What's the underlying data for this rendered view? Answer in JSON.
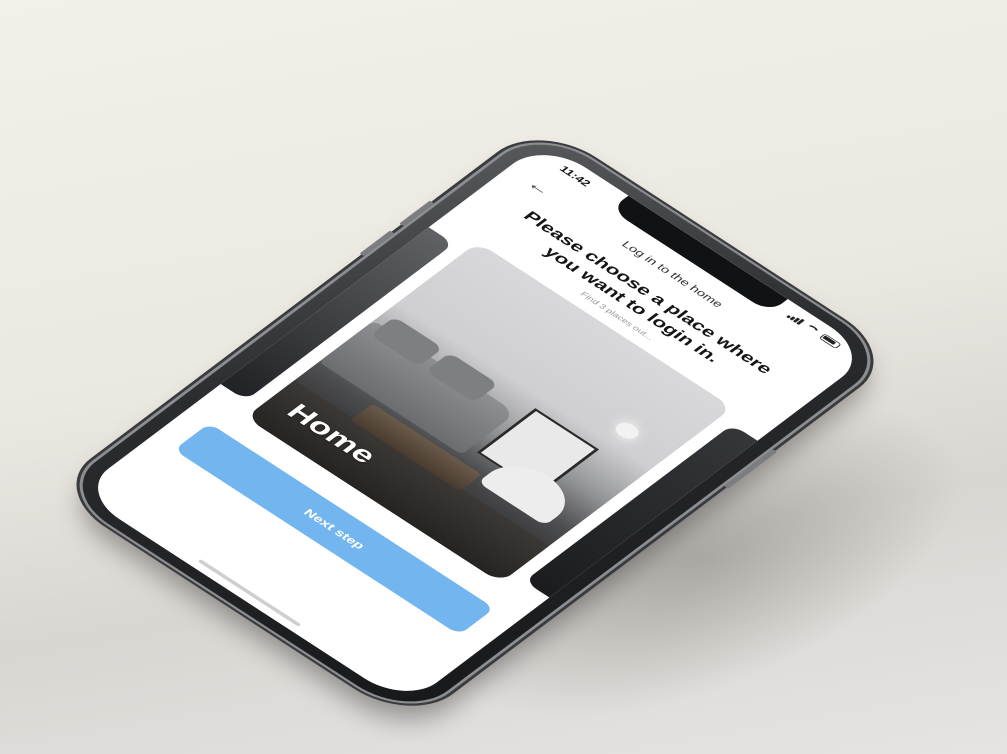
{
  "status_bar": {
    "time": "11:42"
  },
  "header": {
    "title": "Log in to the home",
    "back_icon": "arrow-left-icon"
  },
  "main": {
    "heading": "Please choose a place where you want to login in.",
    "subheading": "Find 3 places out...",
    "cards": [
      {
        "label": "Home"
      }
    ]
  },
  "footer": {
    "next_button_label": "Next step"
  },
  "colors": {
    "accent": "#73b6ef",
    "background": "#ffffff"
  }
}
